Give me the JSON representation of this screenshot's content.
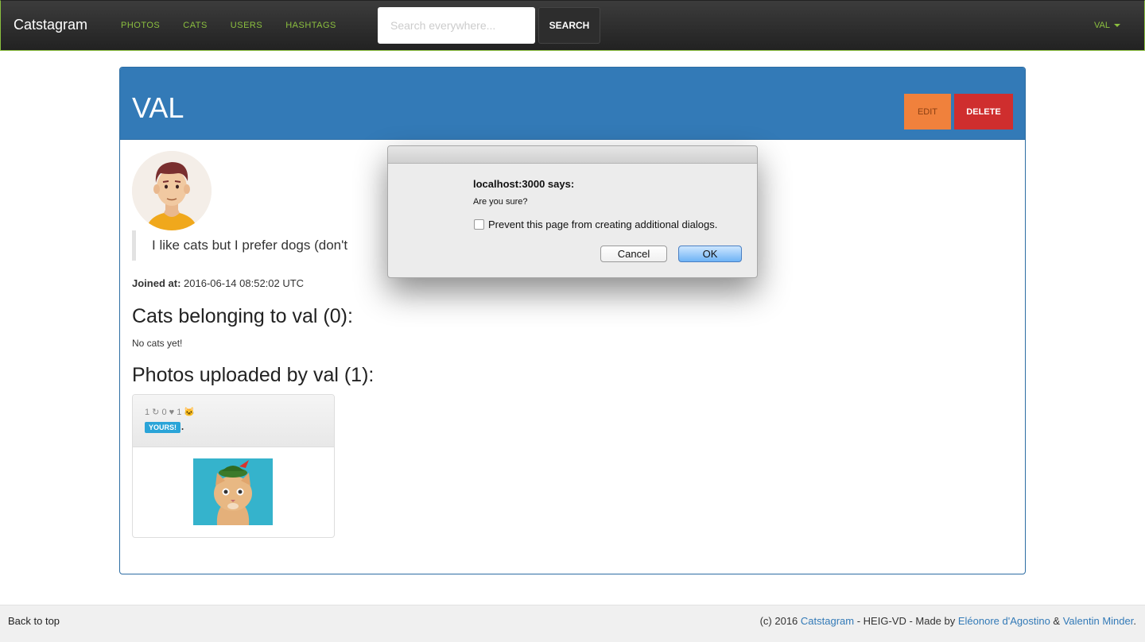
{
  "navbar": {
    "brand": "Catstagram",
    "links": [
      "PHOTOS",
      "CATS",
      "USERS",
      "HASHTAGS"
    ],
    "search_placeholder": "Search everywhere...",
    "search_button": "SEARCH",
    "user_menu": "VAL"
  },
  "profile": {
    "title": "VAL",
    "edit_label": "EDIT",
    "delete_label": "DELETE",
    "bio": "I like cats but I prefer dogs (don't",
    "joined_label": "Joined at:",
    "joined_value": "2016-06-14 08:52:02 UTC",
    "cats_heading": "Cats belonging to val (0):",
    "no_cats": "No cats yet!",
    "photos_heading": "Photos uploaded by val (1):"
  },
  "photo_card": {
    "stats": "1 ↻ 0 ♥ 1 🐱",
    "badge": "YOURS!",
    "badge_suffix": "."
  },
  "dialog": {
    "title": "localhost:3000 says:",
    "message": "Are you sure?",
    "checkbox_label": "Prevent this page from creating additional dialogs.",
    "cancel_label": "Cancel",
    "ok_label": "OK"
  },
  "footer": {
    "back_to_top": "Back to top",
    "credits_prefix": "(c) 2016 ",
    "credits_brand": "Catstagram",
    "credits_middle": " - HEIG-VD - Made by ",
    "author1": "Eléonore d'Agostino",
    "credits_and": " & ",
    "author2": "Valentin Minder",
    "credits_suffix": "."
  },
  "colors": {
    "nav_accent": "#8bbf3f",
    "panel_header": "#337ab7",
    "edit_button": "#f0813c",
    "delete_button": "#cf2e2e",
    "badge": "#2aa4d8"
  }
}
